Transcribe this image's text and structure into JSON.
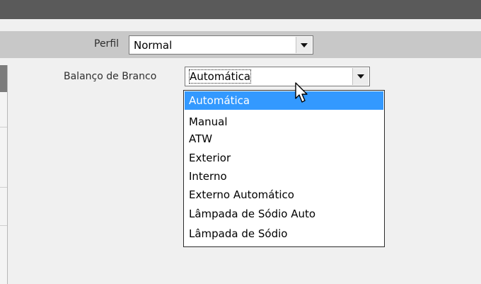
{
  "perfil": {
    "label": "Perfil",
    "value": "Normal"
  },
  "white_balance": {
    "label": "Balanço de Branco",
    "value": "Automática",
    "options": [
      "Automática",
      "Manual",
      "ATW",
      "Exterior",
      "Interno",
      "Externo Automático",
      "Lâmpada de Sódio Auto",
      "Lâmpada de Sódio"
    ],
    "highlighted_index": 0
  },
  "colors": {
    "topbar": "#5a5a5a",
    "row_band": "#c8c8c8",
    "selection": "#3399ff"
  },
  "icons": [
    "dropdown-arrow-icon",
    "mouse-pointer-icon"
  ]
}
